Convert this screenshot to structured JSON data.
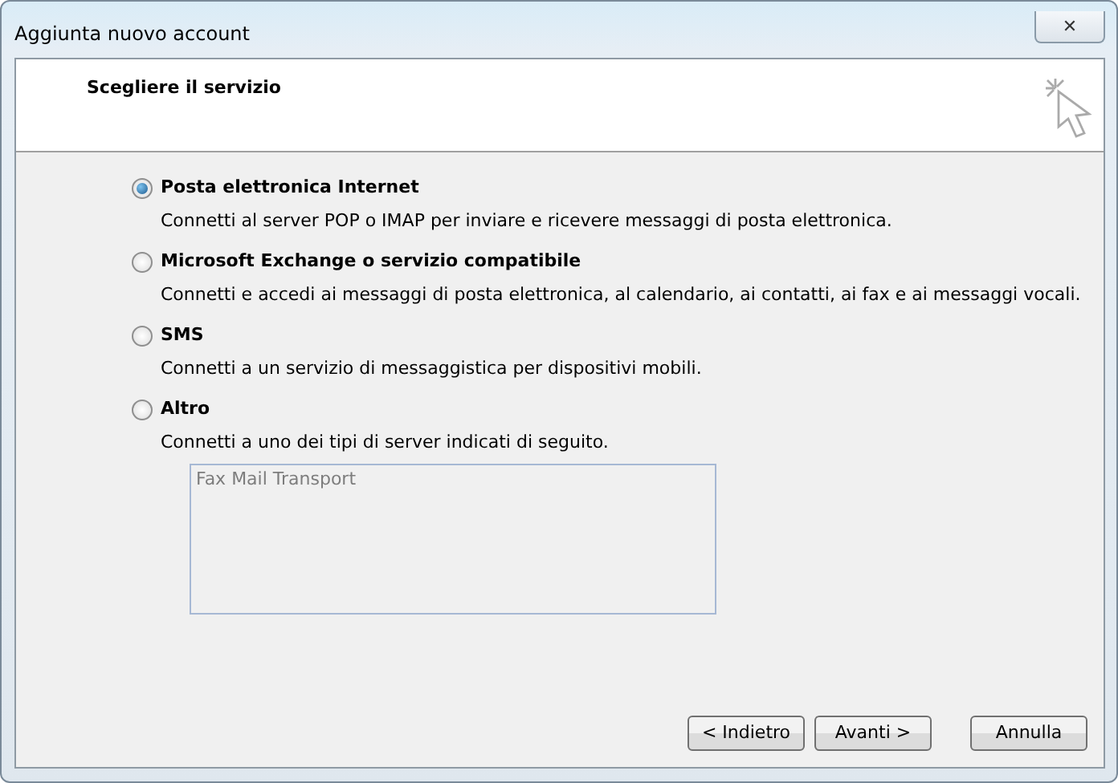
{
  "window": {
    "title": "Aggiunta nuovo account",
    "close": "✕"
  },
  "header": {
    "title": "Scegliere il servizio"
  },
  "options": [
    {
      "label": "Posta elettronica Internet",
      "description": "Connetti al server POP o IMAP per inviare e ricevere messaggi di posta elettronica.",
      "selected": true
    },
    {
      "label": "Microsoft Exchange o servizio compatibile",
      "description": "Connetti e accedi ai messaggi di posta elettronica, al calendario, ai contatti, ai fax e ai messaggi vocali.",
      "selected": false
    },
    {
      "label": "SMS",
      "description": "Connetti a un servizio di messaggistica per dispositivi mobili.",
      "selected": false
    },
    {
      "label": "Altro",
      "description": "Connetti a uno dei tipi di server indicati di seguito.",
      "selected": false
    }
  ],
  "server_list": {
    "disabled": true,
    "items": [
      "Fax Mail Transport"
    ]
  },
  "buttons": [
    "< Indietro",
    "Avanti >",
    "Annulla"
  ]
}
